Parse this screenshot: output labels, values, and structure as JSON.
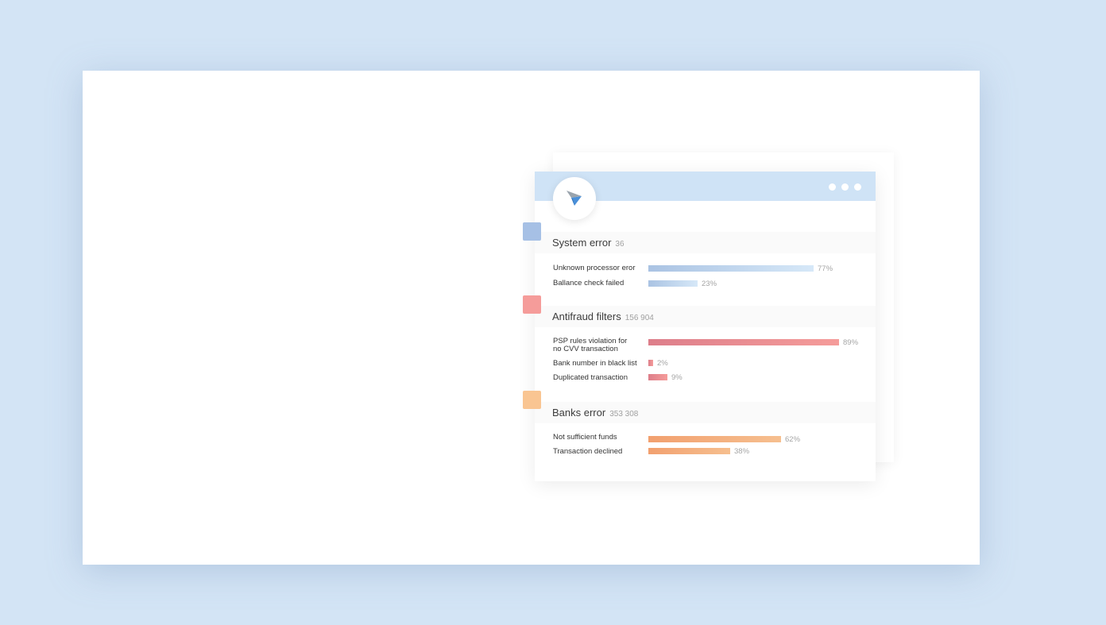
{
  "colors": {
    "system": "#a6c0e5",
    "antifraud": "#f59c9a",
    "banks": "#f9c592",
    "header": "#cfe3f6"
  },
  "logo_icon": "paper-plane-icon",
  "sections": [
    {
      "title": "System error",
      "count": "36",
      "rows": [
        {
          "label": "Unknown processor eror",
          "percent": 77,
          "percent_label": "77%"
        },
        {
          "label": "Ballance check failed",
          "percent": 23,
          "percent_label": "23%"
        }
      ]
    },
    {
      "title": "Antifraud filters",
      "count": "156 904",
      "rows": [
        {
          "label": "PSP rules violation for\nno CVV transaction",
          "percent": 89,
          "percent_label": "89%"
        },
        {
          "label": "Bank number in black list",
          "percent": 2,
          "percent_label": "2%"
        },
        {
          "label": "Duplicated transaction",
          "percent": 9,
          "percent_label": "9%"
        }
      ]
    },
    {
      "title": "Banks error",
      "count": "353 308",
      "rows": [
        {
          "label": "Not sufficient funds",
          "percent": 62,
          "percent_label": "62%"
        },
        {
          "label": "Transaction declined",
          "percent": 38,
          "percent_label": "38%"
        }
      ]
    }
  ]
}
